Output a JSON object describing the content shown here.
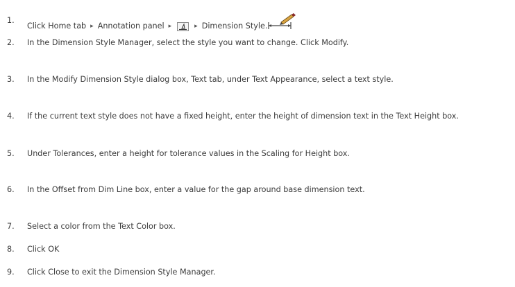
{
  "steps": [
    {
      "num": "1.",
      "parts": [
        "Click Home tab",
        "▸",
        "Annotation panel",
        "▸",
        "▸",
        "Dimension Style."
      ],
      "icons": [
        "annotation-panel-icon",
        "dimension-style-icon"
      ]
    },
    {
      "num": "2.",
      "text": "In the Dimension Style Manager, select the style you want to change. Click Modify."
    },
    {
      "num": "3.",
      "text": "In the Modify Dimension Style dialog box, Text tab, under Text Appearance, select a text style."
    },
    {
      "num": "4.",
      "text": "If the current text style does not have a fixed height, enter the height of dimension text in the Text Height box."
    },
    {
      "num": "5.",
      "text": "Under Tolerances, enter a height for tolerance values in the Scaling for Height box."
    },
    {
      "num": "6.",
      "text": "In the Offset from Dim Line box, enter a value for the gap around base dimension text."
    },
    {
      "num": "7.",
      "text": "Select a color from the Text Color box."
    },
    {
      "num": "8.",
      "text": "Click OK"
    },
    {
      "num": "9.",
      "text": "Click Close to exit the Dimension Style Manager."
    }
  ]
}
